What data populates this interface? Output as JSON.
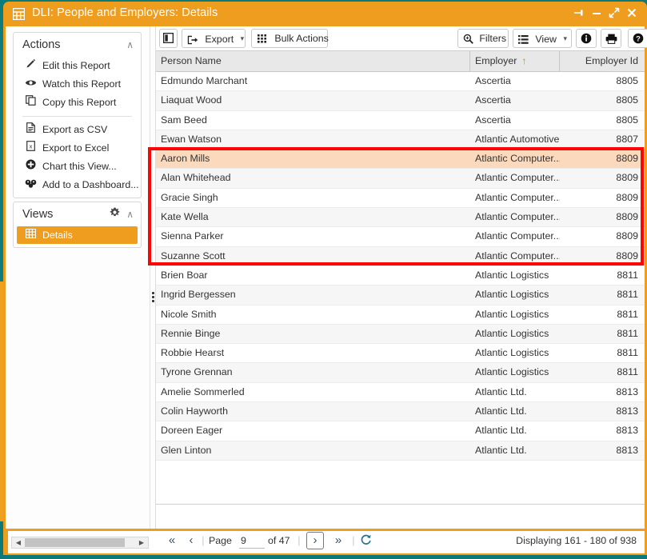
{
  "window": {
    "title": "DLI: People and Employers: Details",
    "app_icon": "grid-icon",
    "controls": {
      "pin": "✐",
      "minimize": "—",
      "maximize": "⤢",
      "close": "✕"
    },
    "accent_color": "#ef9d1f",
    "desktop_color": "#0e7c7b"
  },
  "sidebar": {
    "actions": {
      "title": "Actions",
      "caret": "∧",
      "items": [
        {
          "label": "Edit this Report",
          "icon": "pencil-icon",
          "glyph": "✎"
        },
        {
          "label": "Watch this Report",
          "icon": "eye-icon",
          "glyph": "◉"
        },
        {
          "label": "Copy this Report",
          "icon": "copy-icon",
          "glyph": "❐"
        },
        {
          "label": "Export as CSV",
          "icon": "document-icon",
          "glyph": "὜E"
        },
        {
          "label": "Export to Excel",
          "icon": "excel-icon",
          "glyph": "X"
        },
        {
          "label": "Chart this View...",
          "icon": "plus-circle-icon",
          "glyph": "⊕"
        },
        {
          "label": "Add to a Dashboard...",
          "icon": "dashboard-icon",
          "glyph": "☸"
        }
      ],
      "separator_after_index": 2
    },
    "views": {
      "title": "Views",
      "gear": "⚙",
      "caret": "∧",
      "items": [
        {
          "label": "Details",
          "icon": "grid-icon",
          "glyph": "░",
          "selected": true
        }
      ]
    }
  },
  "toolbar": {
    "panel_toggle": {
      "label": "",
      "icon": "panel-toggle-icon",
      "glyph": "◧"
    },
    "export": {
      "label": "Export",
      "icon": "export-icon",
      "glyph": "⮊",
      "caret": "⌄"
    },
    "bulk_actions": {
      "label": "Bulk Actions",
      "icon": "grid-dots-icon",
      "glyph": "☷"
    },
    "filters": {
      "label": "Filters",
      "icon": "search-icon",
      "glyph": "⌕"
    },
    "view": {
      "label": "View",
      "icon": "list-icon",
      "glyph": "☰",
      "caret": "⌄"
    },
    "info": {
      "label": "",
      "icon": "info-icon",
      "glyph": "ℹ"
    },
    "print": {
      "label": "",
      "icon": "printer-icon",
      "glyph": "⎙"
    },
    "help": {
      "label": "",
      "icon": "help-icon",
      "glyph": "?"
    }
  },
  "grid": {
    "columns": [
      {
        "key": "person_name",
        "label": "Person Name",
        "align": "left",
        "sorted": false
      },
      {
        "key": "employer",
        "label": "Employer",
        "align": "left",
        "sorted": true,
        "sort_dir": "asc",
        "sort_glyph": "↑"
      },
      {
        "key": "employer_id",
        "label": "Employer Id",
        "align": "right",
        "sorted": false
      }
    ],
    "rows": [
      {
        "person_name": "Edmundo Marchant",
        "employer": "Ascertia",
        "employer_id": "8805",
        "selected": false
      },
      {
        "person_name": "Liaquat Wood",
        "employer": "Ascertia",
        "employer_id": "8805",
        "selected": false
      },
      {
        "person_name": "Sam Beed",
        "employer": "Ascertia",
        "employer_id": "8805",
        "selected": false
      },
      {
        "person_name": "Ewan Watson",
        "employer": "Atlantic Automotive",
        "employer_id": "8807",
        "selected": false
      },
      {
        "person_name": "Aaron Mills",
        "employer": "Atlantic Computer...",
        "employer_id": "8809",
        "selected": true
      },
      {
        "person_name": "Alan Whitehead",
        "employer": "Atlantic Computer...",
        "employer_id": "8809",
        "selected": false
      },
      {
        "person_name": "Gracie Singh",
        "employer": "Atlantic Computer...",
        "employer_id": "8809",
        "selected": false
      },
      {
        "person_name": "Kate Wella",
        "employer": "Atlantic Computer...",
        "employer_id": "8809",
        "selected": false
      },
      {
        "person_name": "Sienna Parker",
        "employer": "Atlantic Computer...",
        "employer_id": "8809",
        "selected": false
      },
      {
        "person_name": "Suzanne Scott",
        "employer": "Atlantic Computer...",
        "employer_id": "8809",
        "selected": false
      },
      {
        "person_name": "Brien Boar",
        "employer": "Atlantic Logistics",
        "employer_id": "8811",
        "selected": false
      },
      {
        "person_name": "Ingrid Bergessen",
        "employer": "Atlantic Logistics",
        "employer_id": "8811",
        "selected": false
      },
      {
        "person_name": "Nicole Smith",
        "employer": "Atlantic Logistics",
        "employer_id": "8811",
        "selected": false
      },
      {
        "person_name": "Rennie Binge",
        "employer": "Atlantic Logistics",
        "employer_id": "8811",
        "selected": false
      },
      {
        "person_name": "Robbie Hearst",
        "employer": "Atlantic Logistics",
        "employer_id": "8811",
        "selected": false
      },
      {
        "person_name": "Tyrone Grennan",
        "employer": "Atlantic Logistics",
        "employer_id": "8811",
        "selected": false
      },
      {
        "person_name": "Amelie Sommerled",
        "employer": "Atlantic Ltd.",
        "employer_id": "8813",
        "selected": false
      },
      {
        "person_name": "Colin Hayworth",
        "employer": "Atlantic Ltd.",
        "employer_id": "8813",
        "selected": false
      },
      {
        "person_name": "Doreen Eager",
        "employer": "Atlantic Ltd.",
        "employer_id": "8813",
        "selected": false
      },
      {
        "person_name": "Glen Linton",
        "employer": "Atlantic Ltd.",
        "employer_id": "8813",
        "selected": false
      }
    ]
  },
  "annotation": {
    "color": "#fb0505",
    "highlighted_rows": [
      "Aaron Mills",
      "Alan Whitehead",
      "Gracie Singh",
      "Kate Wella",
      "Sienna Parker",
      "Suzanne Scott"
    ]
  },
  "footer": {
    "first": "«",
    "prev": "‹",
    "sep": "|",
    "page_label": "Page",
    "page_value": "9",
    "of_label": "of 47",
    "next": "›",
    "last": "»",
    "refresh": "↻",
    "displaying": "Displaying 161 - 180 of 938"
  },
  "scrollbar": {
    "left_arrow": "◀",
    "right_arrow": "▶"
  }
}
